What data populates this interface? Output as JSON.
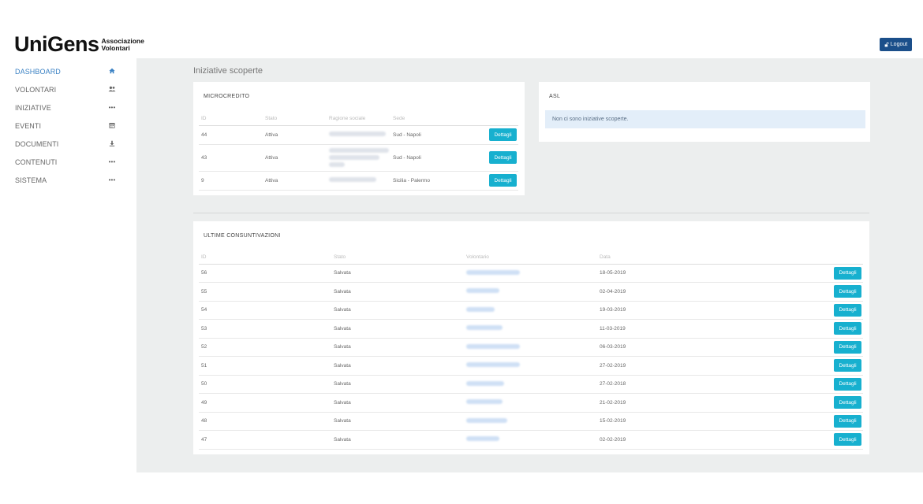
{
  "header": {
    "logo_main": "UniGens",
    "logo_sub_1": "Associazione",
    "logo_sub_2": "Volontari",
    "logout_label": "Logout"
  },
  "sidebar": {
    "items": [
      {
        "label": "DASHBOARD",
        "icon": "home-icon",
        "active": true
      },
      {
        "label": "VOLONTARI",
        "icon": "users-icon",
        "active": false
      },
      {
        "label": "INIZIATIVE",
        "icon": "ellipsis-icon",
        "active": false
      },
      {
        "label": "EVENTI",
        "icon": "calendar-icon",
        "active": false
      },
      {
        "label": "DOCUMENTI",
        "icon": "download-icon",
        "active": false
      },
      {
        "label": "CONTENUTI",
        "icon": "ellipsis-icon",
        "active": false
      },
      {
        "label": "SISTEMA",
        "icon": "ellipsis-icon",
        "active": false
      }
    ]
  },
  "main": {
    "title": "Iniziative scoperte",
    "microcredito": {
      "title": "MICROCREDITO",
      "columns": [
        "ID",
        "Stato",
        "Ragione sociale",
        "Sede"
      ],
      "rows": [
        {
          "id": "44",
          "stato": "Attiva",
          "sede": "Sud - Napoli",
          "action": "Dettagli"
        },
        {
          "id": "43",
          "stato": "Attiva",
          "sede": "Sud - Napoli",
          "action": "Dettagli"
        },
        {
          "id": "9",
          "stato": "Attiva",
          "sede": "Sicilia - Palermo",
          "action": "Dettagli"
        }
      ]
    },
    "asl": {
      "title": "ASL",
      "message": "Non ci sono iniziative scoperte."
    },
    "consuntivazioni": {
      "title": "ULTIME CONSUNTIVAZIONI",
      "columns": [
        "ID",
        "Stato",
        "Volontario",
        "Data"
      ],
      "rows": [
        {
          "id": "56",
          "stato": "Salvata",
          "data": "18-05-2019",
          "action": "Dettagli"
        },
        {
          "id": "55",
          "stato": "Salvata",
          "data": "02-04-2019",
          "action": "Dettagli"
        },
        {
          "id": "54",
          "stato": "Salvata",
          "data": "19-03-2019",
          "action": "Dettagli"
        },
        {
          "id": "53",
          "stato": "Salvata",
          "data": "11-03-2019",
          "action": "Dettagli"
        },
        {
          "id": "52",
          "stato": "Salvata",
          "data": "06-03-2019",
          "action": "Dettagli"
        },
        {
          "id": "51",
          "stato": "Salvata",
          "data": "27-02-2019",
          "action": "Dettagli"
        },
        {
          "id": "50",
          "stato": "Salvata",
          "data": "27-02-2018",
          "action": "Dettagli"
        },
        {
          "id": "49",
          "stato": "Salvata",
          "data": "21-02-2019",
          "action": "Dettagli"
        },
        {
          "id": "48",
          "stato": "Salvata",
          "data": "15-02-2019",
          "action": "Dettagli"
        },
        {
          "id": "47",
          "stato": "Salvata",
          "data": "02-02-2019",
          "action": "Dettagli"
        }
      ]
    }
  },
  "colors": {
    "accent": "#17b0cf",
    "logout": "#1b4f8a",
    "active_nav": "#3b82c4",
    "background": "#eceeee"
  }
}
